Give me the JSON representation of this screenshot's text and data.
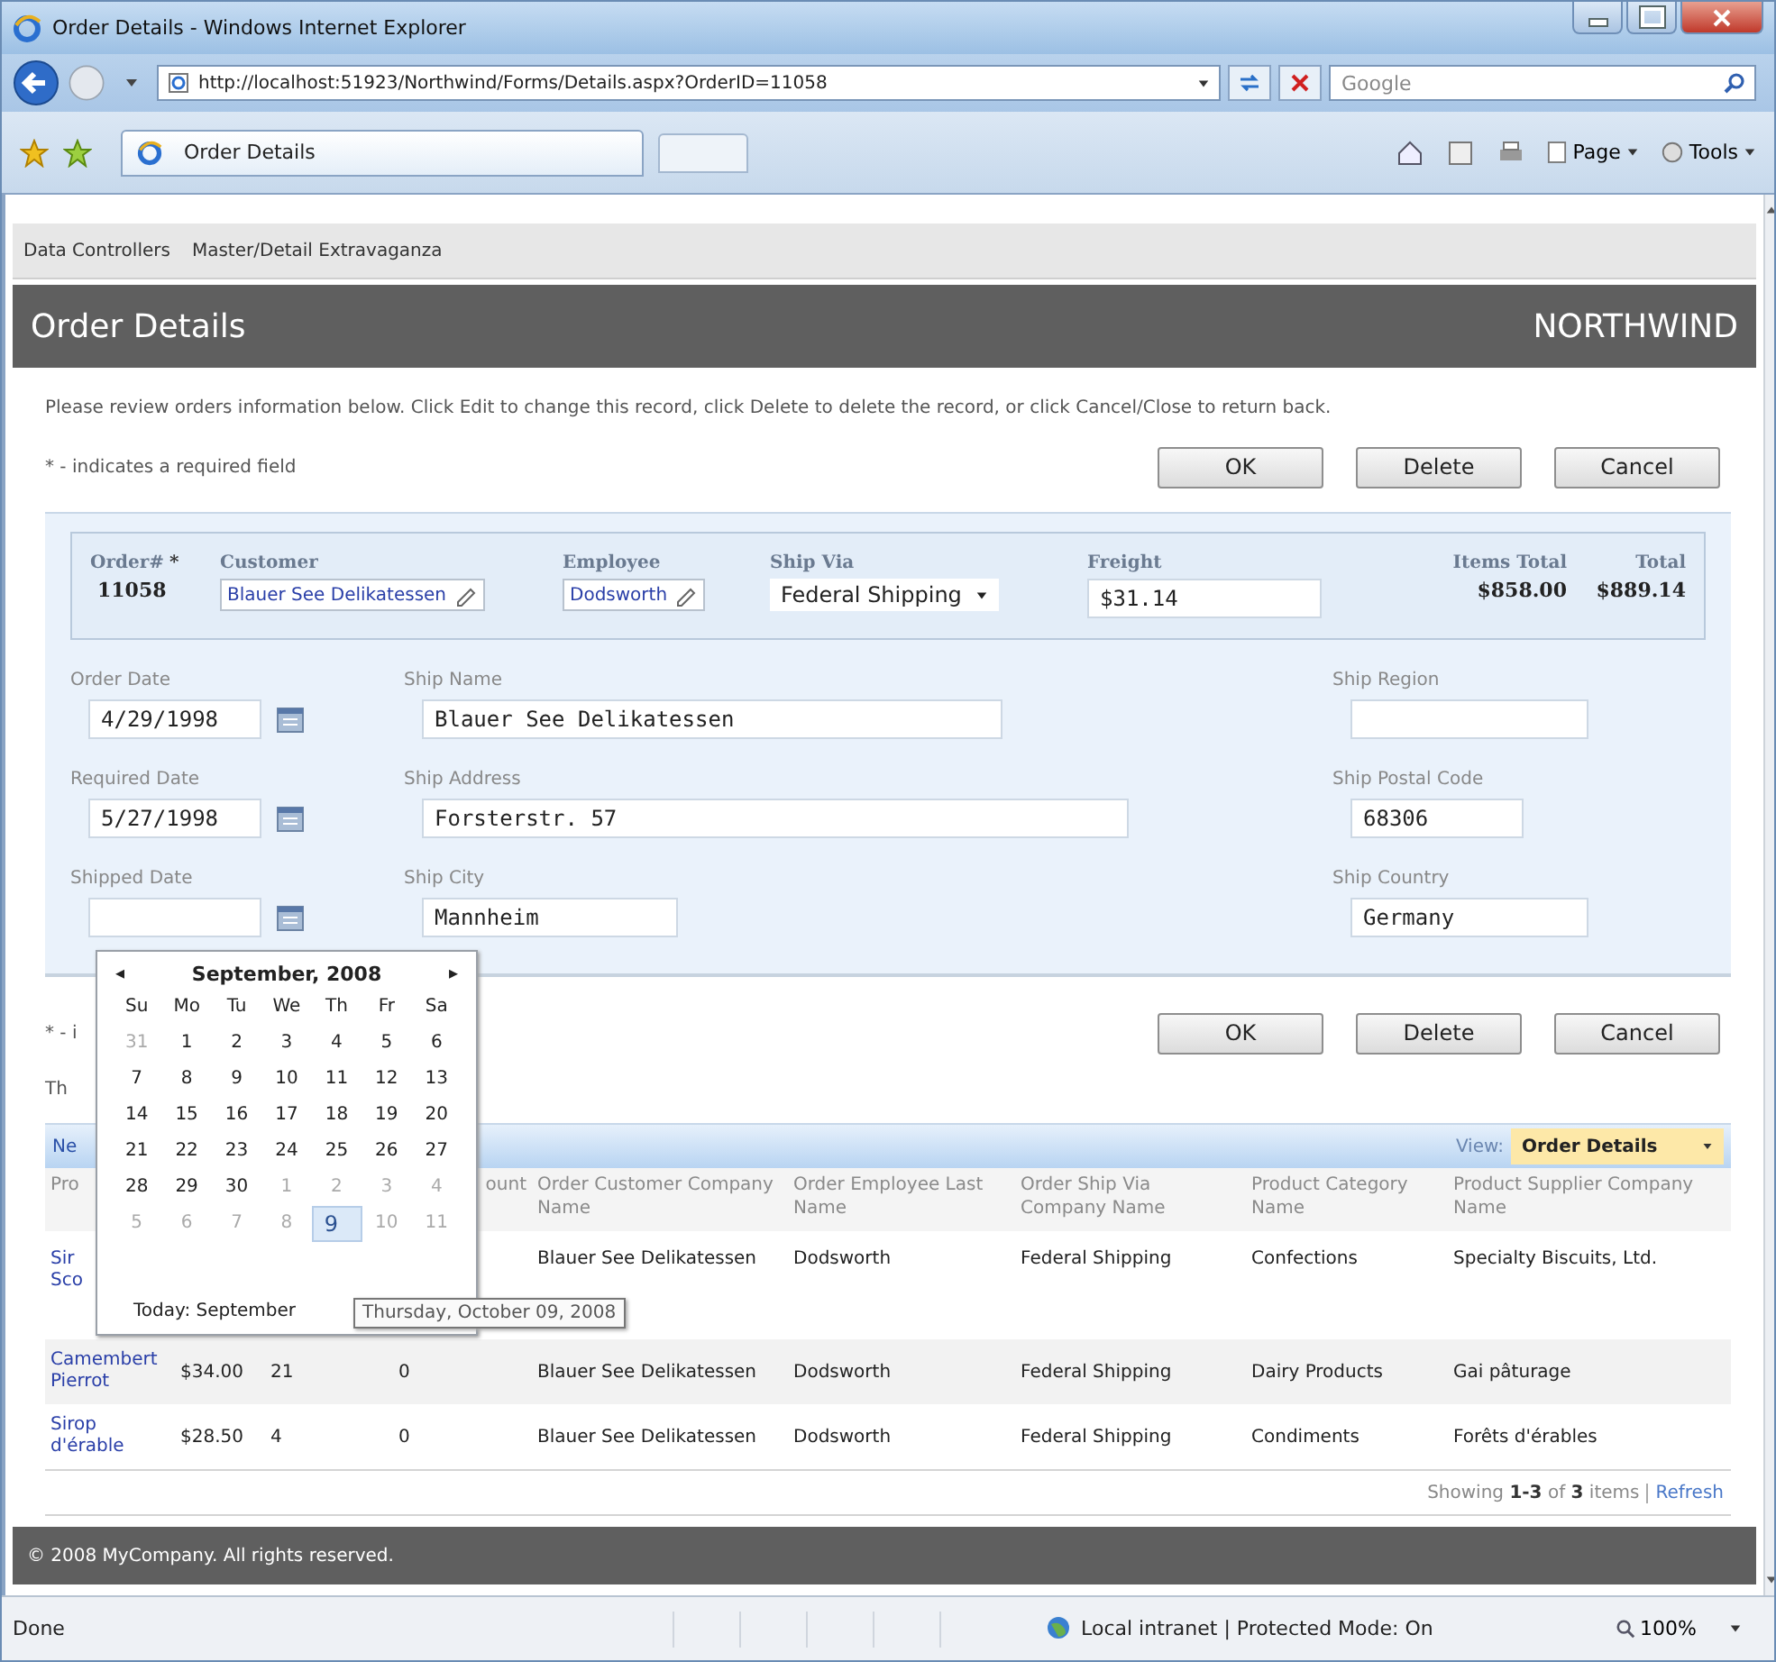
{
  "window": {
    "title": "Order Details - Windows Internet Explorer"
  },
  "address_bar": {
    "url": "http://localhost:51923/Northwind/Forms/Details.aspx?OrderID=11058"
  },
  "search": {
    "placeholder": "Google"
  },
  "tab": {
    "title": "Order Details"
  },
  "commands": [
    {
      "label": "Page"
    },
    {
      "label": "Tools"
    }
  ],
  "menu": [
    "Data Controllers",
    "Master/Detail Extravaganza"
  ],
  "page_header": {
    "title": "Order Details",
    "brand": "NORTHWIND"
  },
  "description": "Please review orders information below. Click Edit to change this record, click Delete to delete the record, or click Cancel/Close to return back.",
  "required_note": "* - indicates a required field",
  "buttons": [
    "OK",
    "Delete",
    "Cancel"
  ],
  "summary": [
    {
      "kind": "text",
      "label": "Order#",
      "mark": "*",
      "value": "11058"
    },
    {
      "kind": "lookup",
      "label": "Customer",
      "value": "Blauer See Delikatessen"
    },
    {
      "kind": "lookup",
      "label": "Employee",
      "value": "Dodsworth"
    },
    {
      "kind": "select",
      "label": "Ship Via",
      "value": "Federal Shipping"
    },
    {
      "kind": "input",
      "label": "Freight",
      "value": "$31.14"
    },
    {
      "kind": "text",
      "label": "Items Total",
      "value": "$858.00"
    },
    {
      "kind": "text",
      "label": "Total",
      "value": "$889.14"
    }
  ],
  "fields": [
    [
      {
        "kind": "date",
        "label": "Order Date",
        "value": "4/29/1998"
      },
      {
        "kind": "text",
        "label": "Ship Name",
        "value": "Blauer See Delikatessen"
      },
      {
        "kind": "text",
        "label": "Ship Region"
      }
    ],
    [
      {
        "kind": "date",
        "label": "Required Date",
        "value": "5/27/1998"
      },
      {
        "kind": "text",
        "label": "Ship Address",
        "value": "Forsterstr. 57"
      },
      {
        "kind": "text",
        "label": "Ship Postal Code",
        "value": "68306"
      }
    ],
    [
      {
        "kind": "date",
        "label": "Shipped Date"
      },
      {
        "kind": "text",
        "label": "Ship City",
        "value": "Mannheim"
      },
      {
        "kind": "text",
        "label": "Ship Country",
        "value": "Germany"
      }
    ]
  ],
  "bottom_bar": {
    "required_note": "* - i",
    "buttons": [
      "OK",
      "Delete",
      "Cancel"
    ]
  },
  "grid_description": "Th",
  "grid_toolbar": {
    "action": "Ne",
    "view_label": "View:",
    "view": "Order Details"
  },
  "table": {
    "columns": {
      "product": "Pro",
      "discount": "ount",
      "customer": "Order Customer Company Name",
      "employee": "Order Employee Last Name",
      "ship_via": "Order Ship Via Company Name",
      "category": "Product Category Name",
      "supplier": "Product Supplier Company Name"
    },
    "rows": [
      {
        "product": "Sir\nSco",
        "customer": "Blauer See Delikatessen",
        "employee": "Dodsworth",
        "ship_via": "Federal Shipping",
        "category": "Confections",
        "supplier": "Specialty Biscuits, Ltd."
      },
      {
        "product": "Camembert Pierrot",
        "unit_price": "$34.00",
        "quantity": "21",
        "discount": "0",
        "customer": "Blauer See Delikatessen",
        "employee": "Dodsworth",
        "ship_via": "Federal Shipping",
        "category": "Dairy Products",
        "supplier": "Gai pâturage"
      },
      {
        "product": "Sirop d'érable",
        "unit_price": "$28.50",
        "quantity": "4",
        "discount": "0",
        "customer": "Blauer See Delikatessen",
        "employee": "Dodsworth",
        "ship_via": "Federal Shipping",
        "category": "Condiments",
        "supplier": "Forêts d'érables"
      }
    ]
  },
  "pager": {
    "text": "Showing **1-3** of **3** items",
    "link": "Refresh"
  },
  "footer": "© 2008 MyCompany. All rights reserved.",
  "calendar": {
    "title": "September, 2008",
    "prev": "◂",
    "next": "▸",
    "weekdays": [
      "Su",
      "Mo",
      "Tu",
      "We",
      "Th",
      "Fr",
      "Sa"
    ],
    "weeks": [
      [
        {
          "label": "31",
          "other_month": true,
          "selected": false
        },
        {
          "label": "1",
          "other_month": false,
          "selected": false
        },
        {
          "label": "2",
          "other_month": false,
          "selected": false
        },
        {
          "label": "3",
          "other_month": false,
          "selected": false
        },
        {
          "label": "4",
          "other_month": false,
          "selected": false
        },
        {
          "label": "5",
          "other_month": false,
          "selected": false
        },
        {
          "label": "6",
          "other_month": false,
          "selected": false
        }
      ],
      [
        {
          "label": "7",
          "other_month": false,
          "selected": false
        },
        {
          "label": "8",
          "other_month": false,
          "selected": false
        },
        {
          "label": "9",
          "other_month": false,
          "selected": false
        },
        {
          "label": "10",
          "other_month": false,
          "selected": false
        },
        {
          "label": "11",
          "other_month": false,
          "selected": false
        },
        {
          "label": "12",
          "other_month": false,
          "selected": false
        },
        {
          "label": "13",
          "other_month": false,
          "selected": false
        }
      ],
      [
        {
          "label": "14",
          "other_month": false,
          "selected": false
        },
        {
          "label": "15",
          "other_month": false,
          "selected": false
        },
        {
          "label": "16",
          "other_month": false,
          "selected": false
        },
        {
          "label": "17",
          "other_month": false,
          "selected": false
        },
        {
          "label": "18",
          "other_month": false,
          "selected": false
        },
        {
          "label": "19",
          "other_month": false,
          "selected": false
        },
        {
          "label": "20",
          "other_month": false,
          "selected": false
        }
      ],
      [
        {
          "label": "21",
          "other_month": false,
          "selected": false
        },
        {
          "label": "22",
          "other_month": false,
          "selected": false
        },
        {
          "label": "23",
          "other_month": false,
          "selected": false
        },
        {
          "label": "24",
          "other_month": false,
          "selected": false
        },
        {
          "label": "25",
          "other_month": false,
          "selected": false
        },
        {
          "label": "26",
          "other_month": false,
          "selected": false
        },
        {
          "label": "27",
          "other_month": false,
          "selected": false
        }
      ],
      [
        {
          "label": "28",
          "other_month": false,
          "selected": false
        },
        {
          "label": "29",
          "other_month": false,
          "selected": false
        },
        {
          "label": "30",
          "other_month": false,
          "selected": false
        },
        {
          "label": "1",
          "other_month": true,
          "selected": false
        },
        {
          "label": "2",
          "other_month": true,
          "selected": false
        },
        {
          "label": "3",
          "other_month": true,
          "selected": false
        },
        {
          "label": "4",
          "other_month": true,
          "selected": false
        }
      ],
      [
        {
          "label": "5",
          "other_month": true,
          "selected": false
        },
        {
          "label": "6",
          "other_month": true,
          "selected": false
        },
        {
          "label": "7",
          "other_month": true,
          "selected": false
        },
        {
          "label": "8",
          "other_month": true,
          "selected": false
        },
        {
          "label": "9",
          "other_month": true,
          "selected": true
        },
        {
          "label": "10",
          "other_month": true,
          "selected": false
        },
        {
          "label": "11",
          "other_month": true,
          "selected": false
        }
      ]
    ],
    "today": "Today: September"
  },
  "tooltip": "Thursday, October 09, 2008",
  "status_bar": {
    "text": "Done",
    "zone": "Local intranet | Protected Mode: On",
    "zoom": "100%"
  }
}
